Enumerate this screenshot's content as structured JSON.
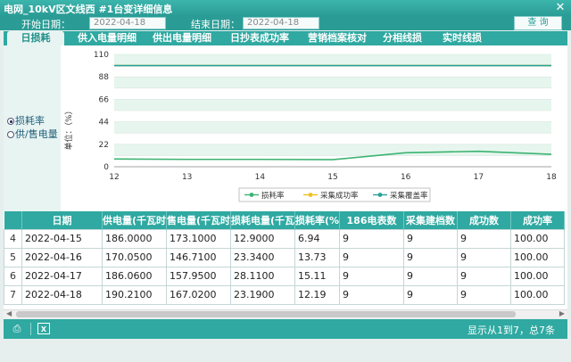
{
  "window": {
    "title": "电网_10kV区文线西    #1台变详细信息",
    "close_label": "✕"
  },
  "query": {
    "start_label": "开始日期：",
    "start_value": "2022-04-18",
    "end_label": "结束日期：",
    "end_value": "2022-04-18",
    "query_button": "查 询"
  },
  "tabs": [
    "日损耗",
    "供入电量明细",
    "供出电量明细",
    "日抄表成功率",
    "营销档案核对",
    "分相线损",
    "实时线损"
  ],
  "radios": [
    {
      "label": "损耗率",
      "checked": true
    },
    {
      "label": "供/售电量",
      "checked": false
    }
  ],
  "chart_data": {
    "type": "line",
    "x": [
      12,
      13,
      14,
      15,
      16,
      17,
      18
    ],
    "xlim": [
      12,
      18
    ],
    "ylim": [
      0,
      110
    ],
    "yticks": [
      0,
      11,
      22,
      33,
      44,
      55,
      66,
      77,
      88,
      99,
      110
    ],
    "ylabel": "单位：（%）",
    "grid": true,
    "legend_position": "bottom",
    "series": [
      {
        "name": "损耗率",
        "color": "#3cb371",
        "x": [
          12,
          13,
          14,
          15,
          16,
          17,
          18
        ],
        "values": [
          7.6,
          7.2,
          7.2,
          6.94,
          13.73,
          15.11,
          12.19
        ]
      },
      {
        "name": "采集成功率",
        "color": "#f0c020",
        "x": [
          12,
          18
        ],
        "values": [
          99,
          99
        ]
      },
      {
        "name": "采集覆盖率",
        "color": "#2aa198",
        "x": [
          12,
          18
        ],
        "values": [
          99,
          99
        ]
      }
    ]
  },
  "table": {
    "columns": [
      "",
      "日期",
      "供电量(千瓦时)",
      "售电量(千瓦时)",
      "损耗电量(千瓦时)",
      "损耗率(%)",
      "186电表数",
      "采集建档数",
      "成功数",
      "成功率"
    ],
    "rows": [
      [
        "4",
        "2022-04-15",
        "186.0000",
        "173.1000",
        "12.9000",
        "6.94",
        "9",
        "9",
        "9",
        "100.00"
      ],
      [
        "5",
        "2022-04-16",
        "170.0500",
        "146.7100",
        "23.3400",
        "13.73",
        "9",
        "9",
        "9",
        "100.00"
      ],
      [
        "6",
        "2022-04-17",
        "186.0600",
        "157.9500",
        "28.1100",
        "15.11",
        "9",
        "9",
        "9",
        "100.00"
      ],
      [
        "7",
        "2022-04-18",
        "190.2100",
        "167.0200",
        "23.1900",
        "12.19",
        "9",
        "9",
        "9",
        "100.00"
      ]
    ]
  },
  "status": {
    "page_info": "显示从1到7，总7条"
  },
  "icons": {
    "print": "printer-icon",
    "excel": "excel-icon"
  }
}
